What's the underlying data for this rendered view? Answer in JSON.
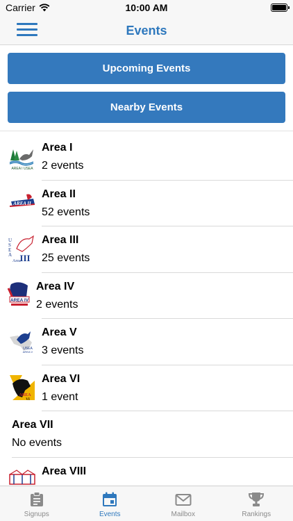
{
  "status_bar": {
    "carrier": "Carrier",
    "time": "10:00 AM"
  },
  "nav": {
    "title": "Events"
  },
  "buttons": {
    "upcoming": "Upcoming Events",
    "nearby": "Nearby Events"
  },
  "events": [
    {
      "name": "Area I",
      "count": "2 events",
      "logo": "area-i-usea-logo",
      "logo_text": "AREA I USEA"
    },
    {
      "name": "Area II",
      "count": "52 events",
      "logo": "area-ii-logo",
      "logo_text": "AREA II"
    },
    {
      "name": "Area III",
      "count": "25 events",
      "logo": "area-iii-logo",
      "logo_text": "USEA Area III"
    },
    {
      "name": "Area IV",
      "count": "2 events",
      "logo": "area-iv-logo",
      "logo_text": "AREA IV"
    },
    {
      "name": "Area V",
      "count": "3 events",
      "logo": "area-v-logo",
      "logo_text": "USEA AREA V"
    },
    {
      "name": "Area VI",
      "count": "1 event",
      "logo": "area-vi-logo",
      "logo_text": "AREA VI"
    },
    {
      "name": "Area VII",
      "count": "No events",
      "logo": null
    },
    {
      "name": "Area VIII",
      "count": "",
      "logo": "area-viii-logo",
      "logo_text": "AREA VIII"
    }
  ],
  "tabs": [
    {
      "label": "Signups",
      "icon": "clipboard-icon",
      "active": false
    },
    {
      "label": "Events",
      "icon": "calendar-icon",
      "active": true
    },
    {
      "label": "Mailbox",
      "icon": "envelope-icon",
      "active": false
    },
    {
      "label": "Rankings",
      "icon": "trophy-icon",
      "active": false
    }
  ],
  "colors": {
    "accent": "#2e78bd",
    "button": "#3479bd",
    "bar_bg": "#f7f7f7",
    "inactive_tab": "#8a8a8a"
  }
}
